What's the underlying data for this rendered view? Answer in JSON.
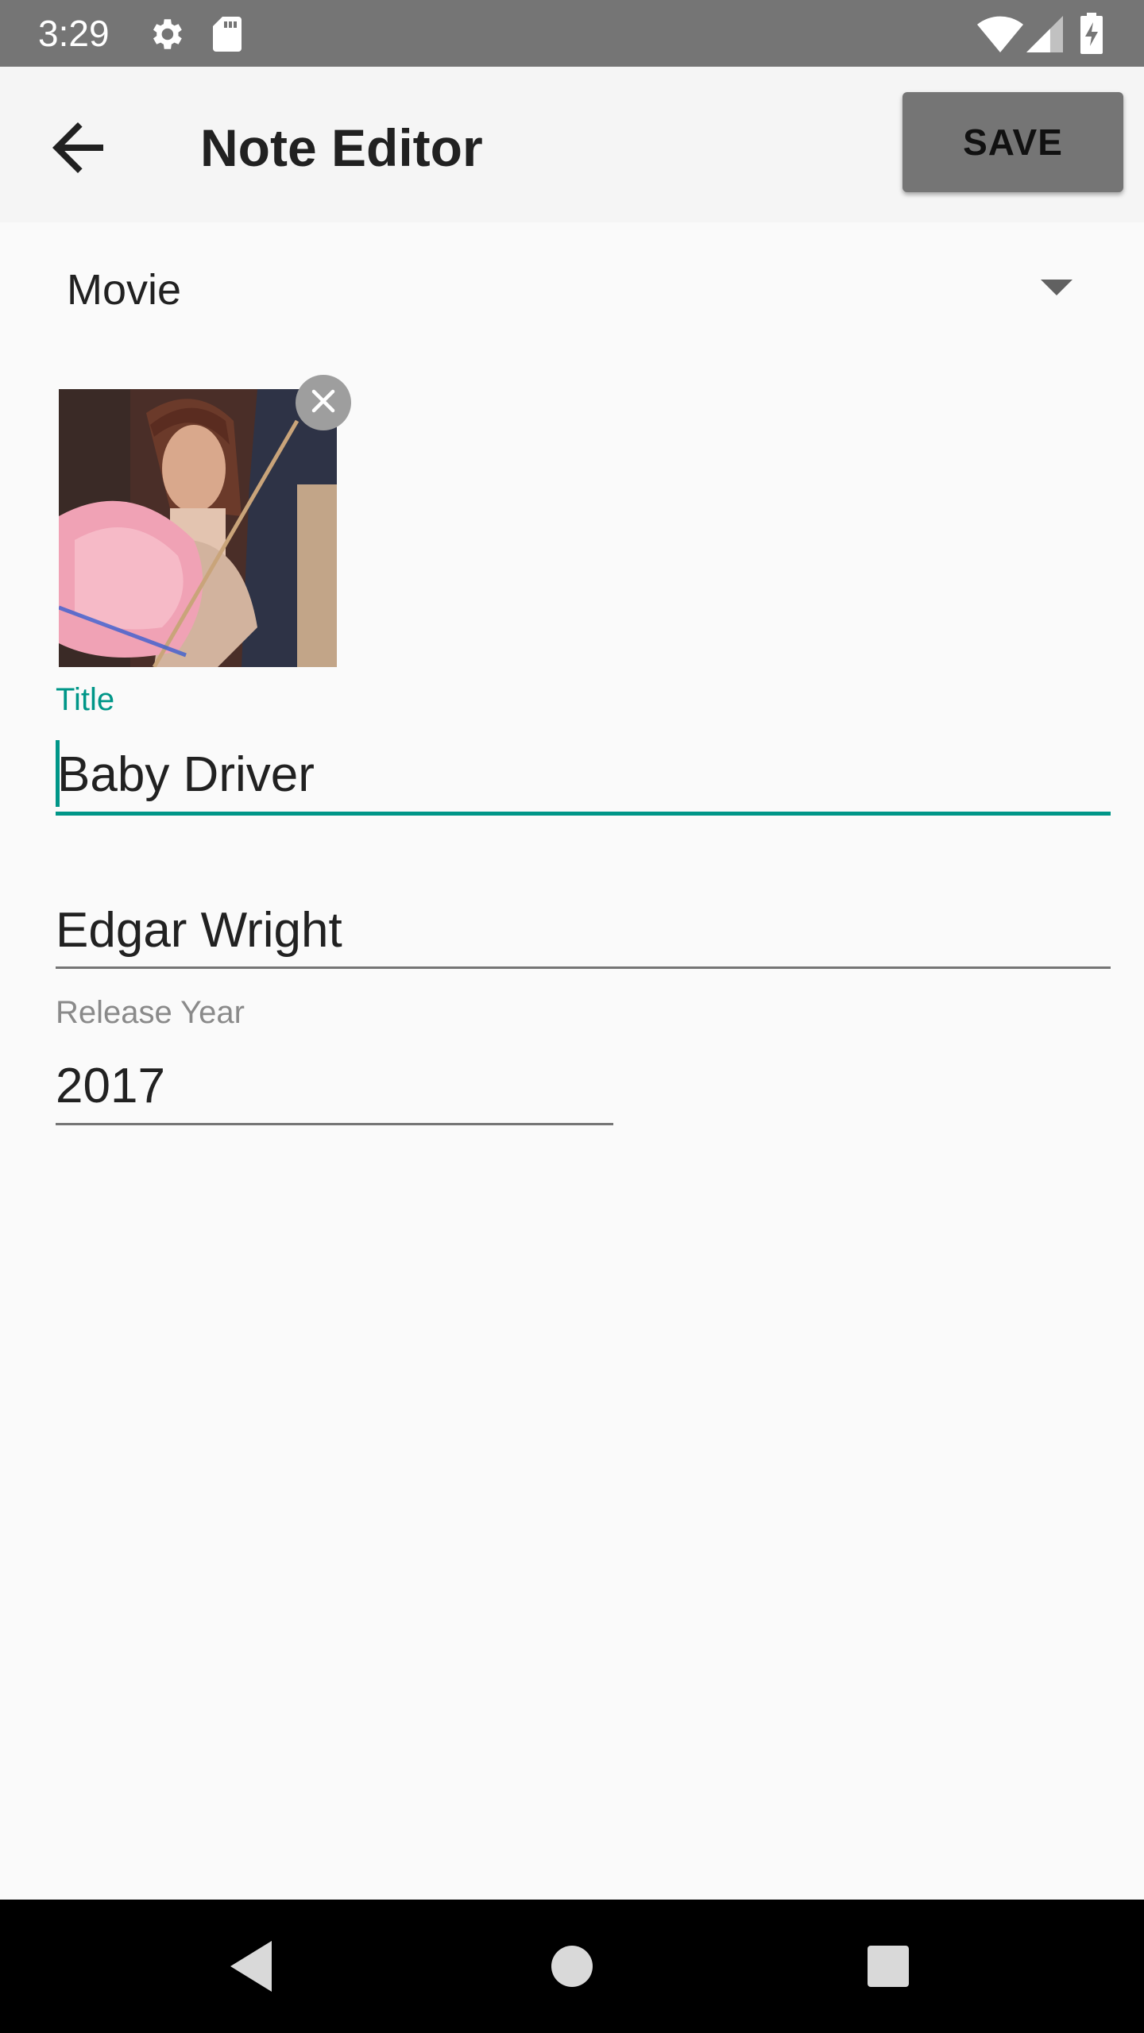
{
  "status_bar": {
    "time": "3:29",
    "icons": [
      "gear-icon",
      "sd-card-icon",
      "wifi-icon",
      "signal-icon",
      "battery-charging-icon"
    ]
  },
  "app_bar": {
    "back_icon": "arrow-back-icon",
    "title": "Note Editor",
    "save_label": "SAVE"
  },
  "type_spinner": {
    "selected": "Movie",
    "icon": "dropdown-arrow-icon"
  },
  "poster": {
    "remove_icon": "close-icon"
  },
  "fields": {
    "title_label": "Title",
    "title_value": "Baby Driver",
    "director_value": "Edgar Wright",
    "release_year_label": "Release Year",
    "release_year_value": "2017"
  },
  "colors": {
    "accent": "#009688",
    "status_bar": "#757575",
    "app_bar": "#f5f5f5",
    "save_button": "#757575",
    "background": "#fafafa",
    "nav_bar": "#000000"
  },
  "nav_bar": {
    "icons": [
      "back-triangle-icon",
      "home-circle-icon",
      "recents-square-icon"
    ]
  }
}
